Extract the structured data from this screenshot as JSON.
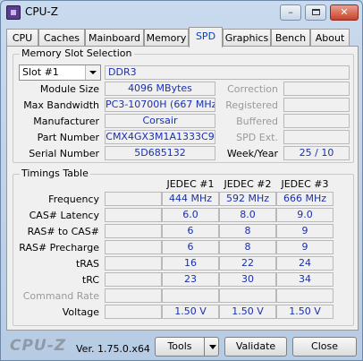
{
  "window": {
    "title": "CPU-Z",
    "icon": "cpu-z-app-icon",
    "min_label": "–",
    "close_label": "✕"
  },
  "tabs": [
    {
      "label": "CPU"
    },
    {
      "label": "Caches"
    },
    {
      "label": "Mainboard"
    },
    {
      "label": "Memory"
    },
    {
      "label": "SPD",
      "active": true
    },
    {
      "label": "Graphics"
    },
    {
      "label": "Bench"
    },
    {
      "label": "About"
    }
  ],
  "slot": {
    "group_title": "Memory Slot Selection",
    "selected": "Slot #1",
    "type": "DDR3",
    "labels": {
      "module_size": "Module Size",
      "max_bandwidth": "Max Bandwidth",
      "manufacturer": "Manufacturer",
      "part_number": "Part Number",
      "serial_number": "Serial Number",
      "correction": "Correction",
      "registered": "Registered",
      "buffered": "Buffered",
      "spd_ext": "SPD Ext.",
      "week_year": "Week/Year"
    },
    "values": {
      "module_size": "4096 MBytes",
      "max_bandwidth": "PC3-10700H (667 MHz)",
      "manufacturer": "Corsair",
      "part_number": "CMX4GX3M1A1333C9",
      "serial_number": "5D685132",
      "correction": "",
      "registered": "",
      "buffered": "",
      "spd_ext": "",
      "week_year": "25 / 10"
    }
  },
  "timings": {
    "group_title": "Timings Table",
    "columns": [
      "JEDEC #1",
      "JEDEC #2",
      "JEDEC #3"
    ],
    "rows": [
      {
        "label": "Frequency",
        "values": [
          "444 MHz",
          "592 MHz",
          "666 MHz"
        ]
      },
      {
        "label": "CAS# Latency",
        "values": [
          "6.0",
          "8.0",
          "9.0"
        ]
      },
      {
        "label": "RAS# to CAS#",
        "values": [
          "6",
          "8",
          "9"
        ]
      },
      {
        "label": "RAS# Precharge",
        "values": [
          "6",
          "8",
          "9"
        ]
      },
      {
        "label": "tRAS",
        "values": [
          "16",
          "22",
          "24"
        ]
      },
      {
        "label": "tRC",
        "values": [
          "23",
          "30",
          "34"
        ]
      },
      {
        "label": "Command Rate",
        "values": [
          "",
          "",
          ""
        ],
        "disabled": true
      },
      {
        "label": "Voltage",
        "values": [
          "1.50 V",
          "1.50 V",
          "1.50 V"
        ]
      }
    ]
  },
  "footer": {
    "brand": "CPU-Z",
    "version": "Ver. 1.75.0.x64",
    "tools_label": "Tools",
    "validate_label": "Validate",
    "close_label": "Close"
  }
}
